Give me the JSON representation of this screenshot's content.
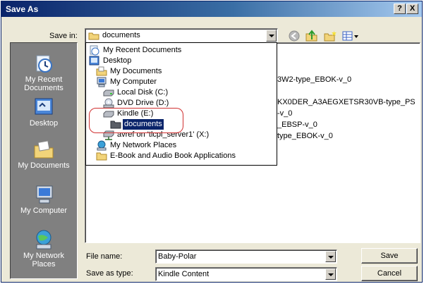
{
  "window": {
    "title": "Save As"
  },
  "title_buttons": {
    "help": "?",
    "close": "X"
  },
  "save_in": {
    "label": "Save in:",
    "value": "documents"
  },
  "places": [
    {
      "label": "My Recent Documents",
      "icon": "recent-documents-icon"
    },
    {
      "label": "Desktop",
      "icon": "desktop-icon"
    },
    {
      "label": "My Documents",
      "icon": "my-documents-icon"
    },
    {
      "label": "My Computer",
      "icon": "my-computer-icon"
    },
    {
      "label": "My Network Places",
      "icon": "network-places-icon"
    }
  ],
  "dropdown_items": [
    {
      "label": "My Recent Documents",
      "icon": "recent-documents-icon"
    },
    {
      "label": "Desktop",
      "icon": "desktop-icon"
    },
    {
      "label": "My Documents",
      "icon": "my-documents-icon"
    },
    {
      "label": "My Computer",
      "icon": "my-computer-icon"
    },
    {
      "label": "Local Disk (C:)",
      "icon": "hard-disk-icon"
    },
    {
      "label": "DVD Drive (D:)",
      "icon": "dvd-drive-icon"
    },
    {
      "label": "Kindle (E:)",
      "icon": "drive-icon"
    },
    {
      "label": "documents",
      "icon": "folder-icon",
      "selected": true
    },
    {
      "label": "avref on 'tlcpl_server1' (X:)",
      "icon": "network-drive-icon"
    },
    {
      "label": "My Network Places",
      "icon": "network-places-icon"
    },
    {
      "label": "E-Book and Audio Book Applications",
      "icon": "folder-icon"
    }
  ],
  "files_partial": [
    "3W2-type_EBOK-v_0",
    "KX0DER_A3AEGXETSR30VB-type_PS",
    "-v_0",
    "_EBSP-v_0",
    "type_EBOK-v_0"
  ],
  "file_name": {
    "label": "File name:",
    "value": "Baby-Polar"
  },
  "save_as_type": {
    "label": "Save as type:",
    "value": "Kindle Content"
  },
  "buttons": {
    "save": "Save",
    "cancel": "Cancel"
  },
  "colors": {
    "title_bar": "#0a246a",
    "selection": "#0a246a",
    "annotation_circle": "#d03030",
    "dialog_bg": "#ece9d8"
  }
}
